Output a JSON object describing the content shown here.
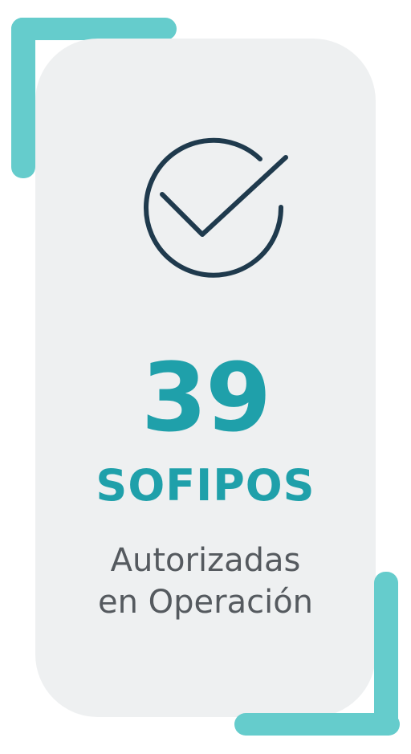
{
  "stat": {
    "number": "39",
    "label": "SOFIPOS",
    "description_line1": "Autorizadas",
    "description_line2": "en Operación"
  },
  "icon": "checkmark-circle-icon",
  "colors": {
    "accent": "#65cccc",
    "number": "#1fa0aa",
    "icon_stroke": "#1f3a4d",
    "card_background": "#eef0f1",
    "text": "#555a5f"
  }
}
